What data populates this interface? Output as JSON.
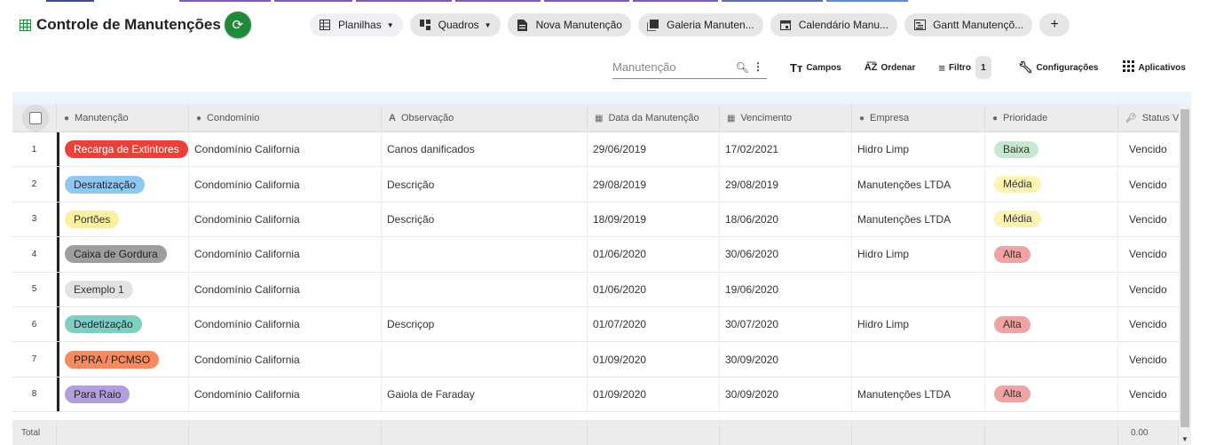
{
  "app": {
    "title": "Controle de Manutenções",
    "accent_color": "#1e8a3a"
  },
  "views": [
    {
      "label": "Planilhas",
      "icon": "table-icon",
      "dropdown": true
    },
    {
      "label": "Quadros",
      "icon": "board-icon",
      "dropdown": true
    },
    {
      "label": "Nova Manutenção",
      "icon": "form-icon",
      "dropdown": false
    },
    {
      "label": "Galeria Manuten...",
      "icon": "gallery-icon",
      "dropdown": false
    },
    {
      "label": "Calendário Manu...",
      "icon": "calendar-icon",
      "dropdown": false
    },
    {
      "label": "Gantt Manutençõ...",
      "icon": "gantt-icon",
      "dropdown": false
    }
  ],
  "toolbar": {
    "search_placeholder": "Manutenção",
    "fields_label": "Campos",
    "sort_label": "Ordenar",
    "filter_label": "Filtro",
    "filter_count": "1",
    "settings_label": "Configurações",
    "apps_label": "Aplicativos"
  },
  "table": {
    "columns": [
      {
        "label": "Manutenção",
        "icon": "check-circle-icon"
      },
      {
        "label": "Condomínio",
        "icon": "link-circle-icon"
      },
      {
        "label": "Observação",
        "icon": "text-icon"
      },
      {
        "label": "Data da Manutenção",
        "icon": "calendar-icon"
      },
      {
        "label": "Vencimento",
        "icon": "calendar-icon"
      },
      {
        "label": "Empresa",
        "icon": "link-circle-icon"
      },
      {
        "label": "Prioridade",
        "icon": "check-circle-icon"
      },
      {
        "label": "Status Ve",
        "icon": "key-icon"
      }
    ],
    "rows": [
      {
        "num": "1",
        "manutencao": "Recarga de Extintores",
        "tag_bg": "#e8413a",
        "tag_fg": "#ffffff",
        "condominio": "Condomínio California",
        "observacao": "Canos danificados",
        "data": "29/06/2019",
        "vencimento": "17/02/2021",
        "empresa": "Hidro Limp",
        "prioridade": "Baixa",
        "prio_bg": "#c6e8cf",
        "status": "Vencido"
      },
      {
        "num": "2",
        "manutencao": "Desratização",
        "tag_bg": "#8ec8f2",
        "tag_fg": "#223",
        "condominio": "Condomínio California",
        "observacao": "Descrição",
        "data": "29/08/2019",
        "vencimento": "29/08/2019",
        "empresa": "Manutenções LTDA",
        "prioridade": "Média",
        "prio_bg": "#fbf4b4",
        "status": "Vencido"
      },
      {
        "num": "3",
        "manutencao": "Portões",
        "tag_bg": "#fbf19c",
        "tag_fg": "#333",
        "condominio": "Condomínio California",
        "observacao": "Descrição",
        "data": "18/09/2019",
        "vencimento": "18/06/2020",
        "empresa": "Manutenções LTDA",
        "prioridade": "Média",
        "prio_bg": "#fbf4b4",
        "status": "Vencido"
      },
      {
        "num": "4",
        "manutencao": "Caixa de Gordura",
        "tag_bg": "#9e9e9e",
        "tag_fg": "#222",
        "condominio": "Condomínio California",
        "observacao": "",
        "data": "01/06/2020",
        "vencimento": "30/06/2020",
        "empresa": "Hidro Limp",
        "prioridade": "Alta",
        "prio_bg": "#f0a3a3",
        "status": "Vencido"
      },
      {
        "num": "5",
        "manutencao": "Exemplo 1",
        "tag_bg": "#e2e2e2",
        "tag_fg": "#333",
        "condominio": "Condomínio California",
        "observacao": "",
        "data": "01/06/2020",
        "vencimento": "19/06/2020",
        "empresa": "",
        "prioridade": "",
        "prio_bg": "",
        "status": "Vencido"
      },
      {
        "num": "6",
        "manutencao": "Dedetização",
        "tag_bg": "#7dcfc2",
        "tag_fg": "#223",
        "condominio": "Condomínio California",
        "observacao": "Descriçop",
        "data": "01/07/2020",
        "vencimento": "30/07/2020",
        "empresa": "Hidro Limp",
        "prioridade": "Alta",
        "prio_bg": "#f0a3a3",
        "status": "Vencido"
      },
      {
        "num": "7",
        "manutencao": "PPRA / PCMSO",
        "tag_bg": "#f98a5e",
        "tag_fg": "#222",
        "condominio": "Condomínio California",
        "observacao": "",
        "data": "01/09/2020",
        "vencimento": "30/09/2020",
        "empresa": "",
        "prioridade": "",
        "prio_bg": "",
        "status": "Vencido"
      },
      {
        "num": "8",
        "manutencao": "Para Raio",
        "tag_bg": "#b49ddc",
        "tag_fg": "#222",
        "condominio": "Condomínio California",
        "observacao": "Gaiola de Faraday",
        "data": "01/09/2020",
        "vencimento": "30/09/2020",
        "empresa": "Manutenções LTDA",
        "prioridade": "Alta",
        "prio_bg": "#f0a3a3",
        "status": "Vencido"
      }
    ],
    "footer_label": "Total",
    "footer_total": "0.00"
  }
}
